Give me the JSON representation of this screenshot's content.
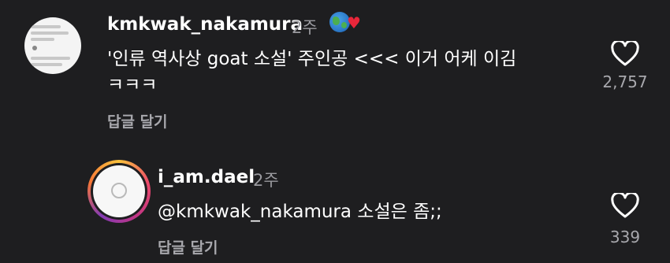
{
  "comment": {
    "username": "kmkwak_nakamura",
    "time": "2주",
    "line1": "'인류 역사상 goat 소설' 주인공 <<< 이거 어케 이김",
    "line2": "ㅋㅋㅋ",
    "reply_label": "답글 달기",
    "likes": "2,757",
    "avatar_icon": "post-thumbnail-avatar",
    "badge_icons": [
      "globe-emoji-icon",
      "red-heart-emoji-icon"
    ]
  },
  "reply": {
    "username": "i_am.dael",
    "time": "2주",
    "text": "@kmkwak_nakamura 소설은 좀;;",
    "reply_label": "답글 달기",
    "likes": "339",
    "avatar_icon": "story-ring-avatar"
  },
  "colors": {
    "background": "#1e1e20",
    "secondary_text": "#a8a8ad",
    "story_ring": "#ee4b6a"
  }
}
